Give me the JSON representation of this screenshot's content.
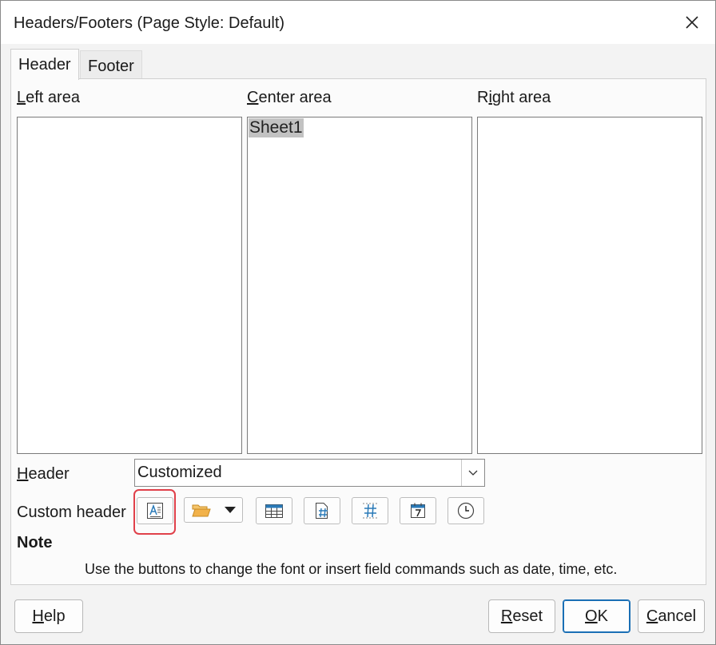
{
  "window": {
    "title": "Headers/Footers (Page Style: Default)"
  },
  "tabs": [
    {
      "label": "Header",
      "active": true
    },
    {
      "label": "Footer",
      "active": false
    }
  ],
  "areas": {
    "left": {
      "label_mnemonic": "L",
      "label_rest": "eft area",
      "content": ""
    },
    "center": {
      "label_mnemonic": "C",
      "label_rest": "enter area",
      "content": "Sheet1"
    },
    "right": {
      "label_pre": "R",
      "label_mnemonic": "i",
      "label_rest": "ght area",
      "content": ""
    }
  },
  "header_field": {
    "label_mnemonic": "H",
    "label_rest": "eader",
    "value": "Customized"
  },
  "custom_header": {
    "label": "Custom header",
    "buttons": [
      {
        "name": "text-attributes-icon",
        "highlighted": true
      },
      {
        "name": "open-folder-icon",
        "has_dropdown": true
      },
      {
        "name": "sheet-name-icon"
      },
      {
        "name": "page-number-icon"
      },
      {
        "name": "page-count-icon"
      },
      {
        "name": "date-icon"
      },
      {
        "name": "time-icon"
      }
    ]
  },
  "note": {
    "title": "Note",
    "text": "Use the buttons to change the font or insert field commands such as date, time, etc."
  },
  "footer_buttons": {
    "help": {
      "mnemonic": "H",
      "rest": "elp"
    },
    "reset": {
      "mnemonic": "R",
      "rest": "eset"
    },
    "ok": {
      "mnemonic": "O",
      "rest": "K"
    },
    "cancel": {
      "mnemonic": "C",
      "rest": "ancel"
    }
  },
  "colors": {
    "highlight_border": "#e0404a",
    "default_button_border": "#1a6fb5",
    "selection_bg": "#c2c2c2",
    "icon_blue": "#2a7ab8",
    "folder_orange": "#e8a33a"
  }
}
